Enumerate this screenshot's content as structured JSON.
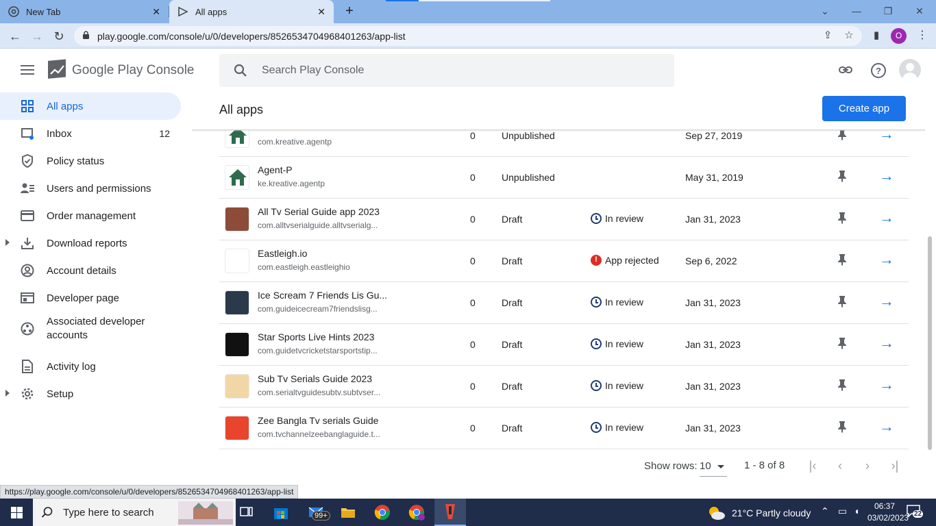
{
  "browser": {
    "tabs": [
      {
        "title": "New Tab"
      },
      {
        "title": "All apps"
      }
    ],
    "url": "play.google.com/console/u/0/developers/8526534704968401263/app-list",
    "profile_initial": "O",
    "status_url": "https://play.google.com/console/u/0/developers/8526534704968401263/app-list"
  },
  "header": {
    "brand": "Google Play Console",
    "search_placeholder": "Search Play Console"
  },
  "sidebar": {
    "items": [
      {
        "label": "All apps",
        "icon": "grid-icon",
        "active": true
      },
      {
        "label": "Inbox",
        "icon": "inbox-icon",
        "count": "12"
      },
      {
        "label": "Policy status",
        "icon": "shield-icon"
      },
      {
        "label": "Users and permissions",
        "icon": "users-icon"
      },
      {
        "label": "Order management",
        "icon": "card-icon"
      },
      {
        "label": "Download reports",
        "icon": "download-icon",
        "expandable": true
      },
      {
        "label": "Account details",
        "icon": "account-icon"
      },
      {
        "label": "Developer page",
        "icon": "web-page-icon"
      },
      {
        "label": "Associated developer accounts",
        "icon": "associated-accounts-icon"
      },
      {
        "label": "Activity log",
        "icon": "document-icon"
      },
      {
        "label": "Setup",
        "icon": "gear-icon",
        "expandable": true
      }
    ]
  },
  "main": {
    "title": "All apps",
    "create_button": "Create app",
    "rows": [
      {
        "name": "",
        "package": "com.kreative.agentp",
        "installs": "0",
        "status": "Unpublished",
        "update": "",
        "update_type": "",
        "date": "Sep 27, 2019",
        "icon_color": "#ffffff"
      },
      {
        "name": "Agent-P",
        "package": "ke.kreative.agentp",
        "installs": "0",
        "status": "Unpublished",
        "update": "",
        "update_type": "",
        "date": "May 31, 2019",
        "icon_color": "#ffffff"
      },
      {
        "name": "All Tv Serial Guide app 2023",
        "package": "com.alltvserialguide.alltvserialg...",
        "installs": "0",
        "status": "Draft",
        "update": "In review",
        "update_type": "review",
        "date": "Jan 31, 2023",
        "icon_color": "#8d4b3a"
      },
      {
        "name": "Eastleigh.io",
        "package": "com.eastleigh.eastleighio",
        "installs": "0",
        "status": "Draft",
        "update": "App rejected",
        "update_type": "rejected",
        "date": "Sep 6, 2022",
        "icon_color": "#ffffff"
      },
      {
        "name": "Ice Scream 7 Friends Lis Gu...",
        "package": "com.guideicecream7friendslisg...",
        "installs": "0",
        "status": "Draft",
        "update": "In review",
        "update_type": "review",
        "date": "Jan 31, 2023",
        "icon_color": "#2b3a4a"
      },
      {
        "name": "Star Sports Live Hints 2023",
        "package": "com.guidetvcricketstarsportstip...",
        "installs": "0",
        "status": "Draft",
        "update": "In review",
        "update_type": "review",
        "date": "Jan 31, 2023",
        "icon_color": "#111111"
      },
      {
        "name": "Sub Tv Serials Guide 2023",
        "package": "com.serialtvguidesubtv.subtvser...",
        "installs": "0",
        "status": "Draft",
        "update": "In review",
        "update_type": "review",
        "date": "Jan 31, 2023",
        "icon_color": "#f2d7a6"
      },
      {
        "name": "Zee Bangla Tv serials Guide",
        "package": "com.tvchannelzeebanglaguide.t...",
        "installs": "0",
        "status": "Draft",
        "update": "In review",
        "update_type": "review",
        "date": "Jan 31, 2023",
        "icon_color": "#e8452c"
      }
    ]
  },
  "pagination": {
    "show_rows_label": "Show rows:",
    "rows_value": "10",
    "range": "1 - 8 of 8"
  },
  "taskbar": {
    "search_text": "Type here to search",
    "mail_badge": "99+",
    "weather": "21°C  Partly cloudy",
    "time": "06:37",
    "date": "03/02/2023",
    "notifications": "22"
  }
}
